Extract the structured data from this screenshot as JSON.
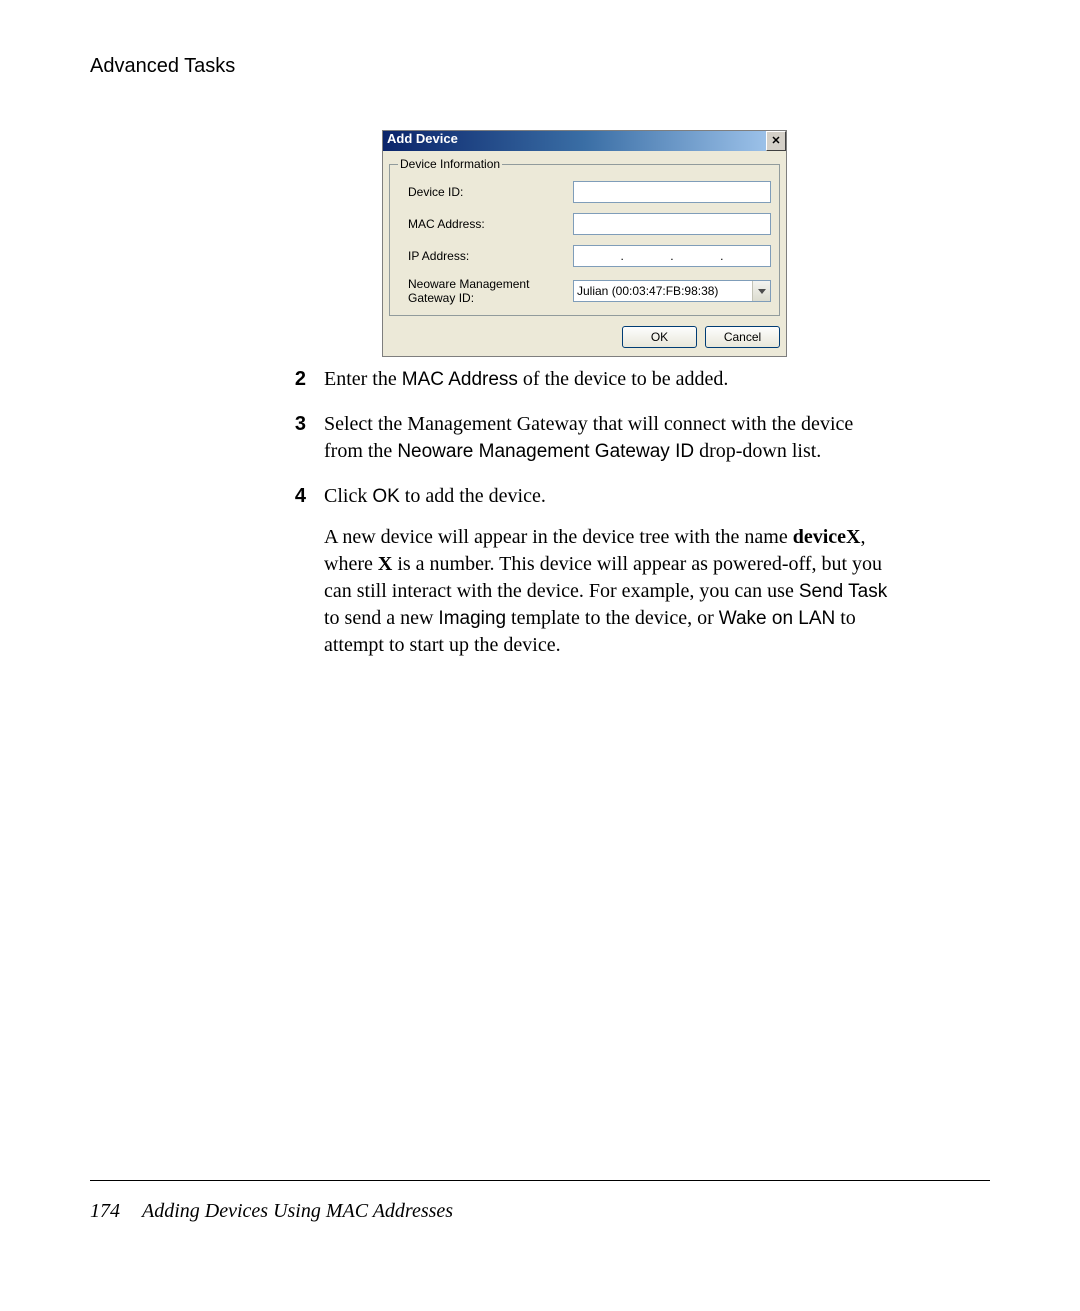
{
  "header": {
    "section_title": "Advanced Tasks"
  },
  "dialog": {
    "title": "Add Device",
    "close_label": "✕",
    "fieldset_legend": "Device Information",
    "labels": {
      "device_id": "Device ID:",
      "mac_address": "MAC Address:",
      "ip_address": "IP Address:",
      "gateway_id": "Neoware Management Gateway ID:"
    },
    "ip_value": {
      "oct1": "",
      "oct2": "",
      "oct3": "",
      "oct4": ""
    },
    "gateway_selected": "Julian (00:03:47:FB:98:38)",
    "buttons": {
      "ok": "OK",
      "cancel": "Cancel"
    }
  },
  "steps": {
    "s2": {
      "num": "2",
      "prefix": "Enter the ",
      "ui1": "MAC Address",
      "suffix": " of the device to be added."
    },
    "s3": {
      "num": "3",
      "line1a": "Select the Management Gateway that will connect with the device from the ",
      "ui1": "Neoware Management Gateway ID",
      "line1b": " drop-down list."
    },
    "s4": {
      "num": "4",
      "prefix": "Click ",
      "ui1": "OK",
      "suffix": " to add the device."
    },
    "para2": {
      "t1": "A new device will appear in the device tree with the name ",
      "b1": "deviceX",
      "t2": ", where ",
      "b2": "X",
      "t3": " is a number. This device will appear as powered-off, but you can still interact with the device. For example, you can use ",
      "ui1": "Send Task",
      "t4": " to send a new ",
      "ui2": "Imaging",
      "t5": " template to the device, or ",
      "ui3": "Wake on LAN",
      "t6": " to attempt to start up the device."
    }
  },
  "footer": {
    "page_number": "174",
    "title": "Adding Devices Using MAC Addresses"
  }
}
